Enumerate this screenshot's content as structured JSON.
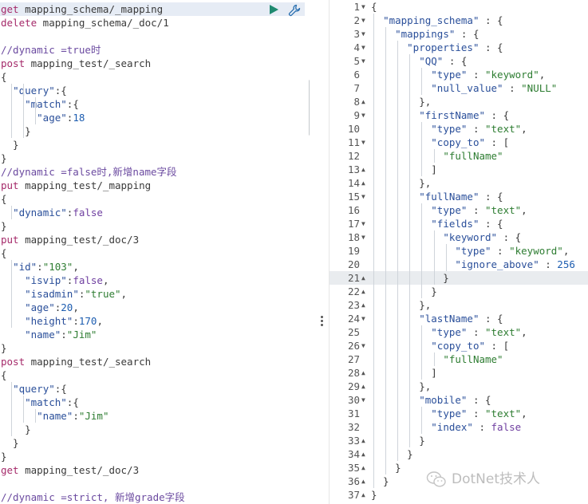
{
  "left_editor": {
    "lines": [
      {
        "t": "req",
        "m": "get",
        "p": " mapping_schema/_mapping"
      },
      {
        "t": "req",
        "m": "delete",
        "p": " mapping_schema/_doc/1"
      },
      {
        "t": "blank"
      },
      {
        "t": "comment",
        "c": "//dynamic =true时"
      },
      {
        "t": "req",
        "m": "post",
        "p": " mapping_test/_search"
      },
      {
        "t": "plain",
        "c": "{"
      },
      {
        "t": "kv",
        "ind": "  ",
        "k": "\"query\"",
        "s": ":{"
      },
      {
        "t": "kv",
        "ind": "    ",
        "k": "\"match\"",
        "s": ":{"
      },
      {
        "t": "kv",
        "ind": "      ",
        "k": "\"age\"",
        "s": ":",
        "v": "18",
        "vt": "num"
      },
      {
        "t": "plain",
        "c": "    }"
      },
      {
        "t": "plain",
        "c": "  }"
      },
      {
        "t": "plain",
        "c": "}"
      },
      {
        "t": "comment",
        "c": "//dynamic =false时,新增name字段"
      },
      {
        "t": "req",
        "m": "put",
        "p": " mapping_test/_mapping"
      },
      {
        "t": "plain",
        "c": "{"
      },
      {
        "t": "kv",
        "ind": "  ",
        "k": "\"dynamic\"",
        "s": ":",
        "v": "false",
        "vt": "kw"
      },
      {
        "t": "plain",
        "c": "}"
      },
      {
        "t": "req",
        "m": "put",
        "p": " mapping_test/_doc/3"
      },
      {
        "t": "plain",
        "c": "{"
      },
      {
        "t": "kv",
        "ind": "  ",
        "k": "\"id\"",
        "s": ":",
        "v": "\"103\"",
        "vt": "str",
        "e": ","
      },
      {
        "t": "kv",
        "ind": "    ",
        "k": "\"isvip\"",
        "s": ":",
        "v": "false",
        "vt": "kw",
        "e": ","
      },
      {
        "t": "kv",
        "ind": "    ",
        "k": "\"isadmin\"",
        "s": ":",
        "v": "\"true\"",
        "vt": "str",
        "e": ","
      },
      {
        "t": "kv",
        "ind": "    ",
        "k": "\"age\"",
        "s": ":",
        "v": "20",
        "vt": "num",
        "e": ","
      },
      {
        "t": "kv",
        "ind": "    ",
        "k": "\"height\"",
        "s": ":",
        "v": "170",
        "vt": "num",
        "e": ","
      },
      {
        "t": "kv",
        "ind": "    ",
        "k": "\"name\"",
        "s": ":",
        "v": "\"Jim\"",
        "vt": "str"
      },
      {
        "t": "plain",
        "c": "}"
      },
      {
        "t": "req",
        "m": "post",
        "p": " mapping_test/_search"
      },
      {
        "t": "plain",
        "c": "{"
      },
      {
        "t": "kv",
        "ind": "  ",
        "k": "\"query\"",
        "s": ":{"
      },
      {
        "t": "kv",
        "ind": "    ",
        "k": "\"match\"",
        "s": ":{"
      },
      {
        "t": "kv",
        "ind": "      ",
        "k": "\"name\"",
        "s": ":",
        "v": "\"Jim\"",
        "vt": "str"
      },
      {
        "t": "plain",
        "c": "    }"
      },
      {
        "t": "plain",
        "c": "  }"
      },
      {
        "t": "plain",
        "c": "}"
      },
      {
        "t": "req",
        "m": "get",
        "p": " mapping_test/_doc/3"
      },
      {
        "t": "blank"
      },
      {
        "t": "comment",
        "c": "//dynamic =strict, 新增grade字段"
      }
    ]
  },
  "right_editor": {
    "active_line": 21,
    "lines": [
      {
        "n": "1",
        "f": true,
        "c": "{"
      },
      {
        "n": "2",
        "f": true,
        "ind": "  ",
        "k": "\"mapping_schema\"",
        "s": " : {"
      },
      {
        "n": "3",
        "f": true,
        "ind": "    ",
        "k": "\"mappings\"",
        "s": " : {"
      },
      {
        "n": "4",
        "f": true,
        "ind": "      ",
        "k": "\"properties\"",
        "s": " : {"
      },
      {
        "n": "5",
        "f": true,
        "ind": "        ",
        "k": "\"QQ\"",
        "s": " : {"
      },
      {
        "n": "6",
        "ind": "          ",
        "k": "\"type\"",
        "s": " : ",
        "v": "\"keyword\"",
        "vt": "str",
        "e": ","
      },
      {
        "n": "7",
        "ind": "          ",
        "k": "\"null_value\"",
        "s": " : ",
        "v": "\"NULL\"",
        "vt": "str"
      },
      {
        "n": "8",
        "fu": true,
        "c": "        },"
      },
      {
        "n": "9",
        "f": true,
        "ind": "        ",
        "k": "\"firstName\"",
        "s": " : {"
      },
      {
        "n": "10",
        "ind": "          ",
        "k": "\"type\"",
        "s": " : ",
        "v": "\"text\"",
        "vt": "str",
        "e": ","
      },
      {
        "n": "11",
        "f": true,
        "ind": "          ",
        "k": "\"copy_to\"",
        "s": " : ["
      },
      {
        "n": "12",
        "ind": "            ",
        "v": "\"fullName\"",
        "vt": "str"
      },
      {
        "n": "13",
        "fu": true,
        "c": "          ]"
      },
      {
        "n": "14",
        "fu": true,
        "c": "        },"
      },
      {
        "n": "15",
        "f": true,
        "ind": "        ",
        "k": "\"fullName\"",
        "s": " : {"
      },
      {
        "n": "16",
        "ind": "          ",
        "k": "\"type\"",
        "s": " : ",
        "v": "\"text\"",
        "vt": "str",
        "e": ","
      },
      {
        "n": "17",
        "f": true,
        "ind": "          ",
        "k": "\"fields\"",
        "s": " : {"
      },
      {
        "n": "18",
        "f": true,
        "ind": "            ",
        "k": "\"keyword\"",
        "s": " : {"
      },
      {
        "n": "19",
        "ind": "              ",
        "k": "\"type\"",
        "s": " : ",
        "v": "\"keyword\"",
        "vt": "str",
        "e": ","
      },
      {
        "n": "20",
        "ind": "              ",
        "k": "\"ignore_above\"",
        "s": " : ",
        "v": "256",
        "vt": "num"
      },
      {
        "n": "21",
        "fu": true,
        "c": "            }"
      },
      {
        "n": "22",
        "fu": true,
        "c": "          }"
      },
      {
        "n": "23",
        "fu": true,
        "c": "        },"
      },
      {
        "n": "24",
        "f": true,
        "ind": "        ",
        "k": "\"lastName\"",
        "s": " : {"
      },
      {
        "n": "25",
        "ind": "          ",
        "k": "\"type\"",
        "s": " : ",
        "v": "\"text\"",
        "vt": "str",
        "e": ","
      },
      {
        "n": "26",
        "f": true,
        "ind": "          ",
        "k": "\"copy_to\"",
        "s": " : ["
      },
      {
        "n": "27",
        "ind": "            ",
        "v": "\"fullName\"",
        "vt": "str"
      },
      {
        "n": "28",
        "fu": true,
        "c": "          ]"
      },
      {
        "n": "29",
        "fu": true,
        "c": "        },"
      },
      {
        "n": "30",
        "f": true,
        "ind": "        ",
        "k": "\"mobile\"",
        "s": " : {"
      },
      {
        "n": "31",
        "ind": "          ",
        "k": "\"type\"",
        "s": " : ",
        "v": "\"text\"",
        "vt": "str",
        "e": ","
      },
      {
        "n": "32",
        "ind": "          ",
        "k": "\"index\"",
        "s": " : ",
        "v": "false",
        "vt": "kw"
      },
      {
        "n": "33",
        "fu": true,
        "c": "        }"
      },
      {
        "n": "34",
        "fu": true,
        "c": "      }"
      },
      {
        "n": "35",
        "fu": true,
        "c": "    }"
      },
      {
        "n": "36",
        "fu": true,
        "c": "  }"
      },
      {
        "n": "37",
        "fu": true,
        "c": "}"
      }
    ]
  },
  "icons": {
    "play": "play-icon",
    "wrench": "wrench-icon",
    "wechat": "wechat-icon"
  },
  "colors": {
    "method": "#a52a6a",
    "key": "#2a4f9a",
    "string": "#2e7d32",
    "play": "#1f8a70"
  },
  "watermark": {
    "text": "DotNet技术人"
  }
}
